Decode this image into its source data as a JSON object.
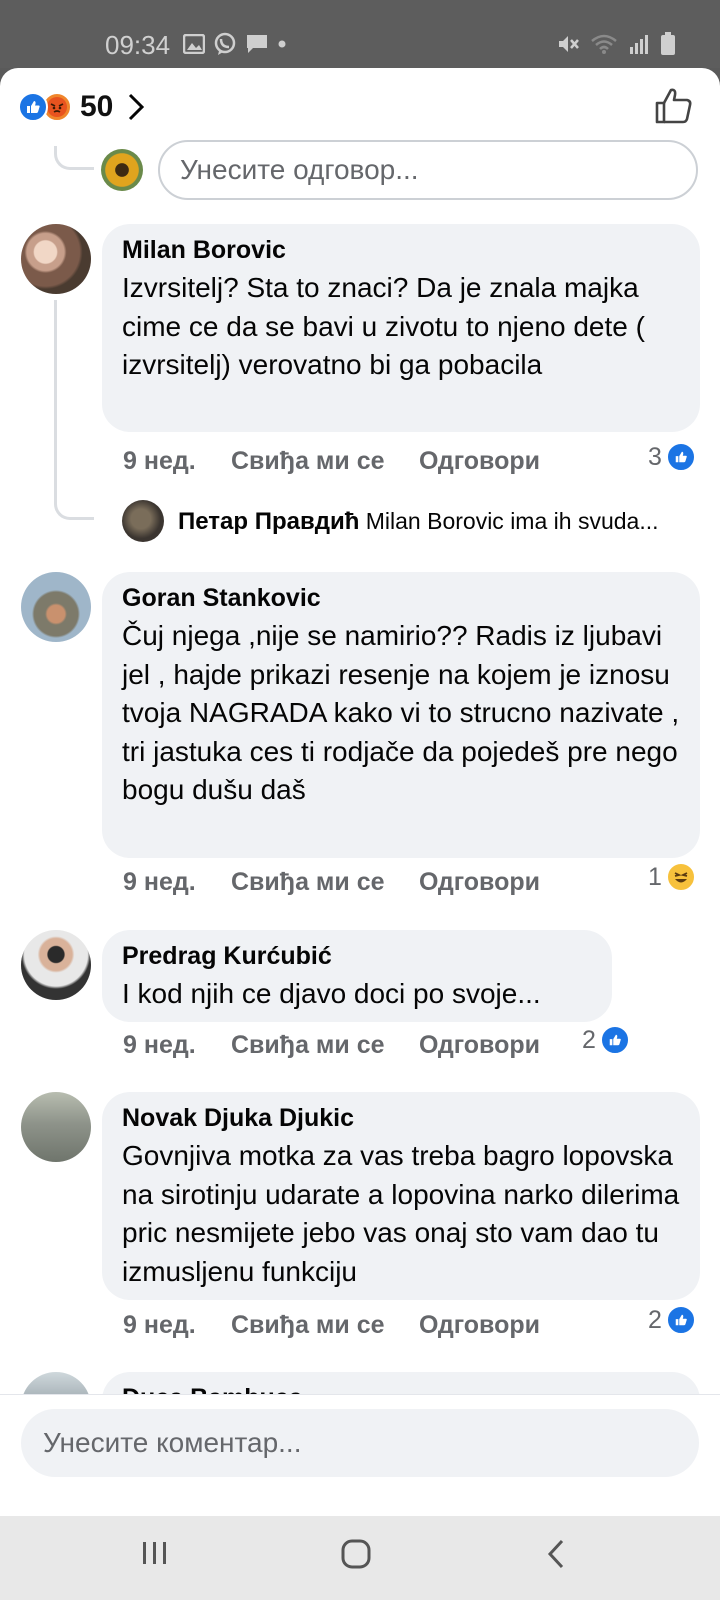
{
  "status_bar": {
    "time": "09:34",
    "left_icons": [
      "image-icon",
      "viber-icon",
      "message-icon",
      "dot-icon"
    ],
    "right_icons": [
      "mute-icon",
      "wifi-icon",
      "signal-icon",
      "battery-icon"
    ]
  },
  "header": {
    "reaction_icons": [
      "like-reaction-icon",
      "angry-reaction-icon"
    ],
    "reaction_count": "50",
    "like_button_icon": "thumbs-up-outline-icon"
  },
  "reply_input": {
    "placeholder": "Унесите одговор..."
  },
  "comments": [
    {
      "author": "Milan Borovic",
      "text": "Izvrsitelj? Sta to znaci? Da je znala majka cime ce da se bavi u zivotu to njeno dete ( izvrsitelj) verovatno bi ga pobacila",
      "time": "9 нед.",
      "like_label": "Свиђа ми се",
      "reply_label": "Одговори",
      "reaction_count": "3",
      "reaction_type": "like"
    },
    {
      "author": "Goran Stankovic",
      "text": "Čuj njega ,nije se namirio?? Radis iz ljubavi jel , hajde prikazi resenje na kojem je iznosu tvoja NAGRADA kako vi to strucno nazivate , tri jastuka ces ti rodjače da pojedeš pre nego bogu dušu daš",
      "time": "9 нед.",
      "like_label": "Свиђа ми се",
      "reply_label": "Одговори",
      "reaction_count": "1",
      "reaction_type": "haha"
    },
    {
      "author": "Predrag Kurćubić",
      "text": "I kod njih ce djavo doci po svoje...",
      "time": "9 нед.",
      "like_label": "Свиђа ми се",
      "reply_label": "Одговори",
      "reaction_count": "2",
      "reaction_type": "like"
    },
    {
      "author": "Novak Djuka Djukic",
      "text": "Govnjiva motka za vas treba bagro lopovska na sirotinju udarate a lopovina narko dilerima pric nesmijete jebo vas onaj sto vam dao tu izmusljenu funkciju",
      "time": "9 нед.",
      "like_label": "Свиђа ми се",
      "reply_label": "Одговори",
      "reaction_count": "2",
      "reaction_type": "like"
    },
    {
      "author": "Duca Bambuca"
    }
  ],
  "sub_reply": {
    "author": "Петар Правдић",
    "preview": "Milan Borovic ima ih svuda..."
  },
  "composer": {
    "placeholder": "Унесите коментар..."
  },
  "nav_bar": {
    "icons": [
      "recent-apps-icon",
      "home-icon",
      "back-icon"
    ]
  }
}
